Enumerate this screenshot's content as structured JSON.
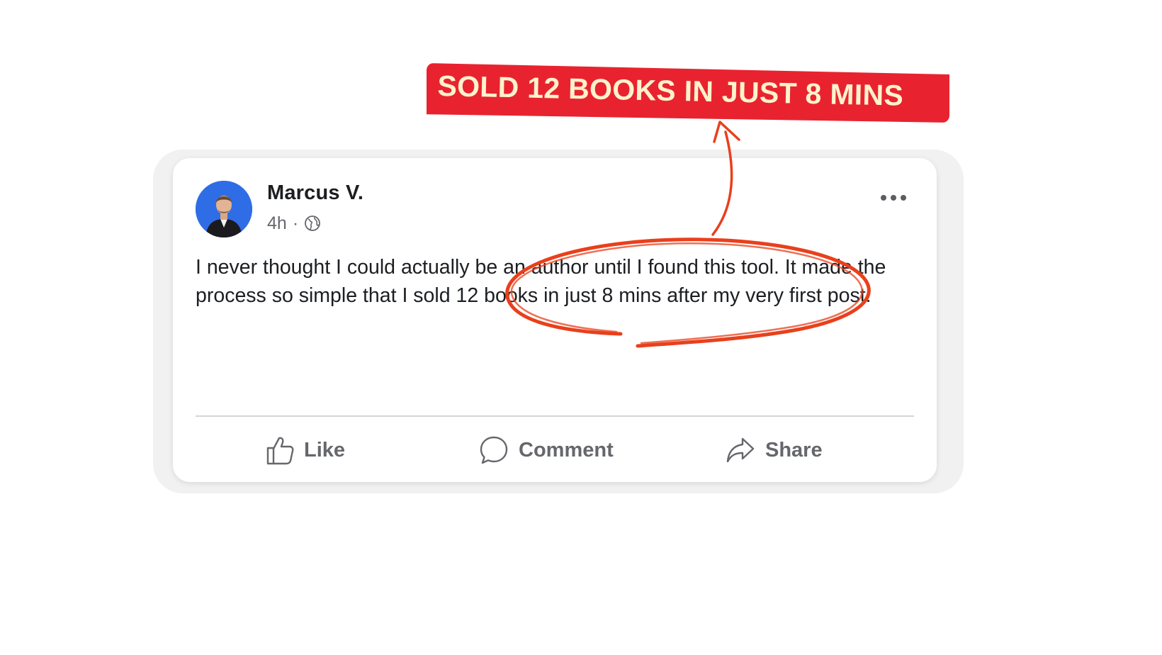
{
  "callout": {
    "text": "SOLD 12 BOOKS IN JUST 8 MINS",
    "background_color": "#e8232f",
    "text_color": "#fff2cc"
  },
  "post": {
    "author": "Marcus V.",
    "time": "4h",
    "separator": "·",
    "privacy_icon": "globe-icon",
    "more_icon": "more-horizontal-icon",
    "text": "I never thought I could actually be an author until I found this tool. It made the process so simple that I sold 12 books in just 8 mins after my very first post!",
    "actions": {
      "like": {
        "label": "Like",
        "icon": "thumbs-up-icon"
      },
      "comment": {
        "label": "Comment",
        "icon": "comment-bubble-icon"
      },
      "share": {
        "label": "Share",
        "icon": "share-arrow-icon"
      }
    }
  },
  "annotation": {
    "circle_icon": "hand-drawn-circle",
    "arrow_icon": "hand-drawn-arrow",
    "color": "#e8401c"
  },
  "colors": {
    "avatar_bg": "#2f6de6",
    "action_text": "#65676b",
    "body_text": "#1c1e21"
  }
}
